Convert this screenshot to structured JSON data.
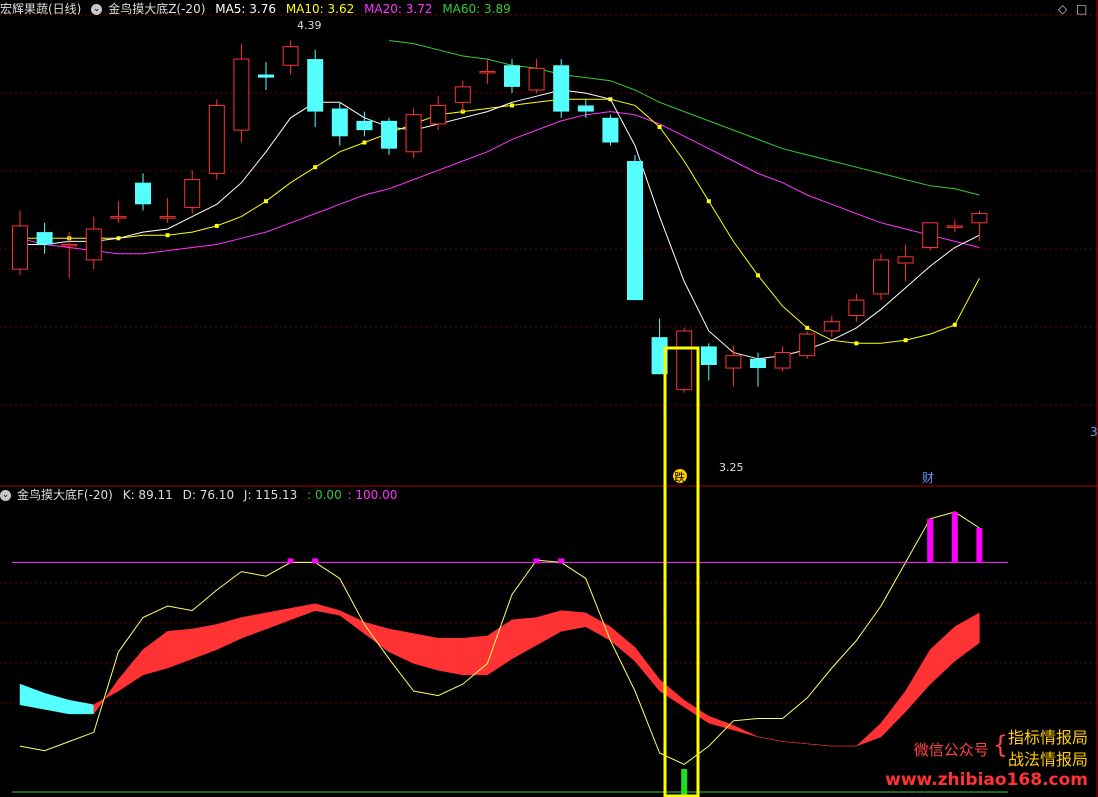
{
  "header": {
    "stock_name": "宏辉果蔬(日线)",
    "indicator": "金鸟摸大底Z(-20)",
    "ma5": "MA5: 3.76",
    "ma10": "MA10: 3.62",
    "ma20": "MA20: 3.72",
    "ma60": "MA60: 3.89"
  },
  "sub_header": {
    "indicator": "金鸟摸大底F(-20)",
    "k": "K: 89.11",
    "d": "D: 76.10",
    "j": "J: 115.13",
    "v0": ": 0.00",
    "v100": ": 100.00"
  },
  "annotations": {
    "high": "4.39",
    "low": "3.25",
    "badge_die": "跌",
    "badge_cai": "财",
    "right_num": "3"
  },
  "watermark": {
    "line_left": "微信公众号",
    "top": "指标情报局",
    "bottom": "战法情报局",
    "url": "www.zhibiao168.com"
  },
  "colors": {
    "up": "#ff3333",
    "down": "#54ffff",
    "ma5": "#ffffff",
    "ma10": "#ffff00",
    "ma20": "#ff33ff",
    "ma60": "#33cc33",
    "highlight": "#ffff00"
  },
  "chart_data": {
    "type": "candlestick",
    "candles": [
      {
        "o": 3.65,
        "c": 3.79,
        "h": 3.84,
        "l": 3.63
      },
      {
        "o": 3.77,
        "c": 3.73,
        "h": 3.8,
        "l": 3.7
      },
      {
        "o": 3.73,
        "c": 3.73,
        "h": 3.77,
        "l": 3.62
      },
      {
        "o": 3.68,
        "c": 3.78,
        "h": 3.82,
        "l": 3.65
      },
      {
        "o": 3.82,
        "c": 3.82,
        "h": 3.87,
        "l": 3.8
      },
      {
        "o": 3.93,
        "c": 3.86,
        "h": 3.96,
        "l": 3.84
      },
      {
        "o": 3.82,
        "c": 3.82,
        "h": 3.88,
        "l": 3.8
      },
      {
        "o": 3.85,
        "c": 3.94,
        "h": 3.97,
        "l": 3.83
      },
      {
        "o": 3.96,
        "c": 4.18,
        "h": 4.2,
        "l": 3.94
      },
      {
        "o": 4.1,
        "c": 4.33,
        "h": 4.38,
        "l": 4.06
      },
      {
        "o": 4.28,
        "c": 4.27,
        "h": 4.32,
        "l": 4.23
      },
      {
        "o": 4.31,
        "c": 4.37,
        "h": 4.39,
        "l": 4.28
      },
      {
        "o": 4.33,
        "c": 4.16,
        "h": 4.36,
        "l": 4.11
      },
      {
        "o": 4.17,
        "c": 4.08,
        "h": 4.19,
        "l": 4.05
      },
      {
        "o": 4.13,
        "c": 4.1,
        "h": 4.16,
        "l": 4.08
      },
      {
        "o": 4.13,
        "c": 4.04,
        "h": 4.14,
        "l": 4.02
      },
      {
        "o": 4.03,
        "c": 4.15,
        "h": 4.17,
        "l": 4.01
      },
      {
        "o": 4.12,
        "c": 4.18,
        "h": 4.21,
        "l": 4.1
      },
      {
        "o": 4.19,
        "c": 4.24,
        "h": 4.26,
        "l": 4.16
      },
      {
        "o": 4.29,
        "c": 4.29,
        "h": 4.33,
        "l": 4.25
      },
      {
        "o": 4.31,
        "c": 4.24,
        "h": 4.33,
        "l": 4.22
      },
      {
        "o": 4.23,
        "c": 4.3,
        "h": 4.33,
        "l": 4.22
      },
      {
        "o": 4.31,
        "c": 4.16,
        "h": 4.33,
        "l": 4.14
      },
      {
        "o": 4.18,
        "c": 4.16,
        "h": 4.2,
        "l": 4.14
      },
      {
        "o": 4.14,
        "c": 4.06,
        "h": 4.15,
        "l": 4.05
      },
      {
        "o": 4.0,
        "c": 3.55,
        "h": 4.02,
        "l": 3.55
      },
      {
        "o": 3.43,
        "c": 3.31,
        "h": 3.49,
        "l": 3.31
      },
      {
        "o": 3.26,
        "c": 3.45,
        "h": 3.46,
        "l": 3.25
      },
      {
        "o": 3.4,
        "c": 3.34,
        "h": 3.41,
        "l": 3.29
      },
      {
        "o": 3.33,
        "c": 3.37,
        "h": 3.4,
        "l": 3.27
      },
      {
        "o": 3.36,
        "c": 3.33,
        "h": 3.38,
        "l": 3.27
      },
      {
        "o": 3.33,
        "c": 3.38,
        "h": 3.4,
        "l": 3.32
      },
      {
        "o": 3.37,
        "c": 3.44,
        "h": 3.45,
        "l": 3.36
      },
      {
        "o": 3.45,
        "c": 3.48,
        "h": 3.5,
        "l": 3.43
      },
      {
        "o": 3.5,
        "c": 3.55,
        "h": 3.57,
        "l": 3.48
      },
      {
        "o": 3.57,
        "c": 3.68,
        "h": 3.7,
        "l": 3.55
      },
      {
        "o": 3.67,
        "c": 3.69,
        "h": 3.73,
        "l": 3.61
      },
      {
        "o": 3.72,
        "c": 3.8,
        "h": 3.8,
        "l": 3.71
      },
      {
        "o": 3.79,
        "c": 3.79,
        "h": 3.81,
        "l": 3.77
      },
      {
        "o": 3.8,
        "c": 3.83,
        "h": 3.84,
        "l": 3.74
      }
    ],
    "ma5": [
      3.73,
      3.73,
      3.74,
      3.74,
      3.75,
      3.77,
      3.78,
      3.82,
      3.86,
      3.93,
      4.03,
      4.14,
      4.19,
      4.19,
      4.14,
      4.11,
      4.1,
      4.12,
      4.14,
      4.16,
      4.19,
      4.21,
      4.23,
      4.22,
      4.2,
      4.05,
      3.82,
      3.61,
      3.45,
      3.38,
      3.36,
      3.37,
      3.39,
      3.42,
      3.46,
      3.52,
      3.59,
      3.66,
      3.72,
      3.76
    ],
    "ma10": [
      3.75,
      3.75,
      3.75,
      3.75,
      3.75,
      3.76,
      3.76,
      3.77,
      3.79,
      3.82,
      3.87,
      3.93,
      3.98,
      4.03,
      4.06,
      4.09,
      4.12,
      4.15,
      4.16,
      4.17,
      4.18,
      4.19,
      4.2,
      4.2,
      4.2,
      4.18,
      4.11,
      4.0,
      3.87,
      3.74,
      3.63,
      3.53,
      3.46,
      3.42,
      3.41,
      3.41,
      3.42,
      3.44,
      3.47,
      3.62
    ],
    "ma20": [
      3.75,
      3.73,
      3.72,
      3.71,
      3.7,
      3.7,
      3.71,
      3.72,
      3.73,
      3.75,
      3.77,
      3.8,
      3.83,
      3.86,
      3.89,
      3.91,
      3.94,
      3.97,
      4.0,
      4.03,
      4.07,
      4.1,
      4.13,
      4.15,
      4.16,
      4.15,
      4.12,
      4.08,
      4.04,
      4.0,
      3.96,
      3.93,
      3.89,
      3.86,
      3.83,
      3.8,
      3.78,
      3.76,
      3.74,
      3.72
    ],
    "ma60": [
      null,
      null,
      null,
      null,
      null,
      null,
      null,
      null,
      null,
      null,
      null,
      null,
      null,
      null,
      null,
      4.39,
      4.38,
      4.36,
      4.34,
      4.33,
      4.31,
      4.3,
      4.28,
      4.27,
      4.26,
      4.23,
      4.19,
      4.16,
      4.13,
      4.1,
      4.07,
      4.04,
      4.02,
      4.0,
      3.98,
      3.96,
      3.94,
      3.92,
      3.91,
      3.89
    ],
    "kdj": {
      "k": [
        38,
        36,
        34,
        34,
        49,
        62,
        70,
        71,
        73,
        76,
        78,
        80,
        82,
        79,
        74,
        71,
        69,
        67,
        67,
        68,
        75,
        76,
        79,
        78,
        72,
        63,
        49,
        40,
        33,
        29,
        24,
        22,
        21,
        20,
        20,
        30,
        44,
        62,
        72,
        78
      ],
      "d": [
        47,
        43,
        40,
        38,
        44,
        51,
        54,
        58,
        62,
        67,
        71,
        75,
        79,
        77,
        69,
        61,
        56,
        53,
        51,
        51,
        58,
        64,
        70,
        72,
        66,
        57,
        44,
        37,
        30,
        27,
        24,
        22,
        21,
        20,
        20,
        24,
        35,
        47,
        57,
        65
      ],
      "j": [
        20,
        18,
        22,
        26,
        61,
        76,
        81,
        79,
        88,
        96,
        94,
        100,
        100,
        93,
        73,
        58,
        44,
        42,
        47,
        56,
        86,
        101,
        100,
        93,
        66,
        44,
        17,
        12,
        20,
        31,
        32,
        32,
        41,
        54,
        66,
        81,
        100,
        119,
        123,
        115
      ]
    },
    "ylim": [
      3.0,
      4.45
    ],
    "kdj_ylim": [
      0,
      125
    ]
  }
}
